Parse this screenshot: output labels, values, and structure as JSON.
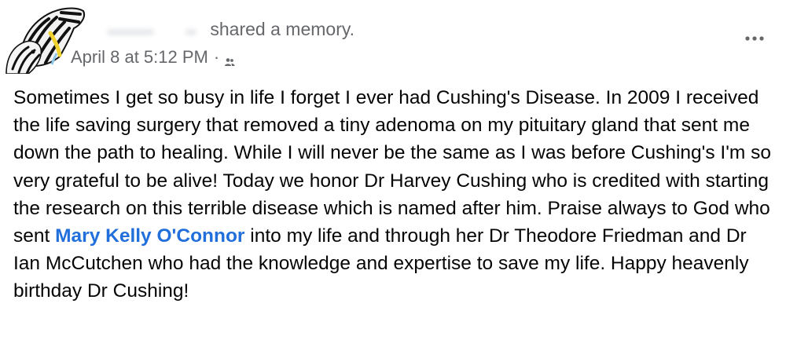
{
  "post": {
    "action_text": "shared a memory.",
    "timestamp": "April 8 at 5:12 PM",
    "separator": "·",
    "audience_icon": "friends-icon",
    "more_icon": "more-options-icon",
    "body": {
      "text_before": "Sometimes I get so busy in life I forget I ever had Cushing's Disease. In 2009 I received the life saving surgery that removed a tiny adenoma on my pituitary gland that sent me down the path to healing.  While I will never be the same as I was before Cushing's I'm so very grateful to be alive!   Today we honor Dr Harvey Cushing who is credited with starting the research on this terrible disease which is named after him.  Praise always to God who sent ",
      "mention": "Mary Kelly O'Connor",
      "text_after": " into my life and through her Dr Theodore Friedman and Dr Ian McCutchen who had the knowledge and expertise to save my life.  Happy heavenly birthday Dr Cushing!"
    },
    "colors": {
      "text": "#050505",
      "secondary": "#65676b",
      "mention": "#216fdb"
    }
  }
}
